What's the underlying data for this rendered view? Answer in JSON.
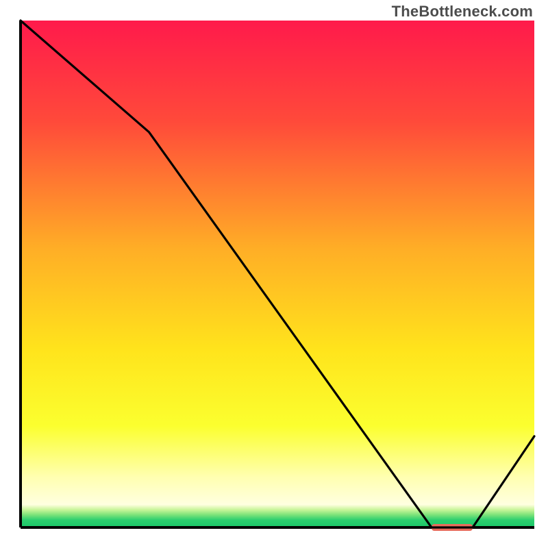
{
  "watermark": "TheBottleneck.com",
  "chart_data": {
    "type": "line",
    "title": "",
    "xlabel": "",
    "ylabel": "",
    "xlim": [
      0,
      100
    ],
    "ylim": [
      0,
      100
    ],
    "series": [
      {
        "name": "bottleneck-curve",
        "x": [
          0,
          25,
          80,
          88,
          100
        ],
        "y": [
          100,
          78,
          0,
          0,
          18
        ]
      }
    ],
    "gradient_stops": [
      {
        "offset": 0.0,
        "color": "#ff1a4b"
      },
      {
        "offset": 0.2,
        "color": "#ff4a3a"
      },
      {
        "offset": 0.45,
        "color": "#ffae26"
      },
      {
        "offset": 0.65,
        "color": "#ffe41c"
      },
      {
        "offset": 0.8,
        "color": "#fbff2f"
      },
      {
        "offset": 0.9,
        "color": "#ffffb0"
      },
      {
        "offset": 0.955,
        "color": "#ffffe0"
      },
      {
        "offset": 0.965,
        "color": "#c8f59a"
      },
      {
        "offset": 0.975,
        "color": "#7de37a"
      },
      {
        "offset": 0.985,
        "color": "#2ecf6f"
      },
      {
        "offset": 1.0,
        "color": "#18c768"
      }
    ],
    "marker": {
      "x_start": 80,
      "x_end": 88,
      "y": 0,
      "color": "#e86b5c"
    },
    "axes": {
      "left_x": 3.75,
      "right_x": 97.5,
      "top_y": 3.75,
      "bottom_y": 96.25
    }
  }
}
